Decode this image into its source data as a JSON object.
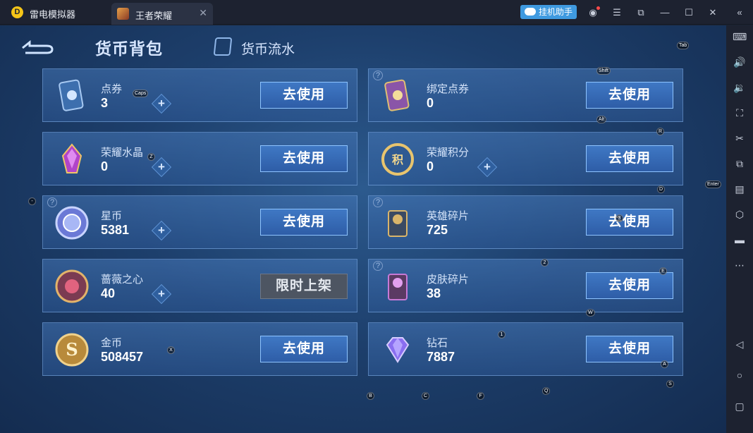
{
  "titlebar": {
    "app_title": "雷电模拟器",
    "tab_label": "王者荣耀",
    "assist_label": "挂机助手"
  },
  "header": {
    "title": "货币背包",
    "flow_label": "货币流水"
  },
  "cards": [
    {
      "name": "点券",
      "value": "3",
      "action": "去使用"
    },
    {
      "name": "绑定点券",
      "value": "0",
      "action": "去使用"
    },
    {
      "name": "荣耀水晶",
      "value": "0",
      "action": "去使用"
    },
    {
      "name": "荣耀积分",
      "value": "0",
      "action": "去使用"
    },
    {
      "name": "星币",
      "value": "5381",
      "action": "去使用"
    },
    {
      "name": "英雄碎片",
      "value": "725",
      "action": "去使用"
    },
    {
      "name": "蔷薇之心",
      "value": "40",
      "action": "限时上架"
    },
    {
      "name": "皮肤碎片",
      "value": "38",
      "action": "去使用"
    },
    {
      "name": "金币",
      "value": "508457",
      "action": "去使用"
    },
    {
      "name": "钻石",
      "value": "7887",
      "action": "去使用"
    }
  ],
  "keymap": {
    "tab": "Tab",
    "shift": "Shift",
    "caps": "Caps",
    "alt": "Alt",
    "r": "R",
    "z": "Z",
    "d": "D",
    "enter": "Enter",
    "minus": "-",
    "three": "3",
    "two": "2",
    "e": "E",
    "w": "W",
    "one": "1",
    "x": "X",
    "a": "A",
    "b": "B",
    "c": "C",
    "f": "F",
    "q": "Q",
    "s": "S"
  },
  "colors": {
    "accent": "#3f9ae0",
    "button": "#3f78c4",
    "panel": "#2c5a8e"
  }
}
